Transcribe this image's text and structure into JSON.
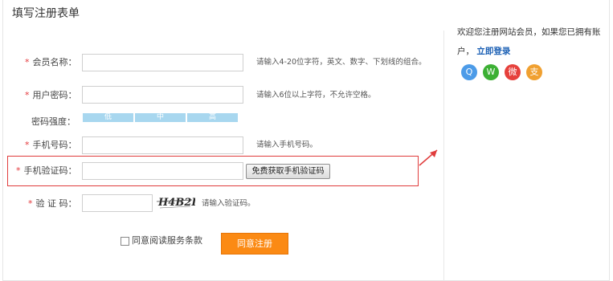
{
  "form": {
    "title": "填写注册表单",
    "fields": {
      "member_name": {
        "label": "会员名称：",
        "value": "",
        "hint": "请输入4-20位字符，英文、数字、下划线的组合。"
      },
      "password": {
        "label": "用户密码：",
        "value": "",
        "hint": "请输入6位以上字符，不允许空格。"
      },
      "strength": {
        "label": "密码强度：",
        "levels": [
          "低",
          "中",
          "高"
        ]
      },
      "phone": {
        "label": "手机号码：",
        "value": "",
        "hint": "请输入手机号码。"
      },
      "sms_code": {
        "label": "手机验证码：",
        "value": "",
        "button": "免费获取手机验证码"
      },
      "captcha": {
        "label": "验 证 码：",
        "value": "",
        "image_text": "H4B2L",
        "hint": "请输入验证码。"
      }
    },
    "required_mark": "*",
    "agree_label": "同意阅读服务条款",
    "submit_label": "同意注册"
  },
  "sidebar": {
    "welcome_text": "欢迎您注册网站会员，如果您已拥有账户，",
    "login_link": "立即登录",
    "social": [
      {
        "name": "qq-icon",
        "glyph": "Q",
        "color": "#4c9be8"
      },
      {
        "name": "wechat-icon",
        "glyph": "W",
        "color": "#3cb034"
      },
      {
        "name": "weibo-icon",
        "glyph": "微",
        "color": "#e6403b"
      },
      {
        "name": "alipay-icon",
        "glyph": "支",
        "color": "#f0a030"
      }
    ]
  },
  "colors": {
    "accent": "#fb8a14",
    "required": "#e4393c",
    "strength_bar": "#a8d7ef",
    "highlight": "#e03c3c",
    "link": "#1a5fb4"
  }
}
